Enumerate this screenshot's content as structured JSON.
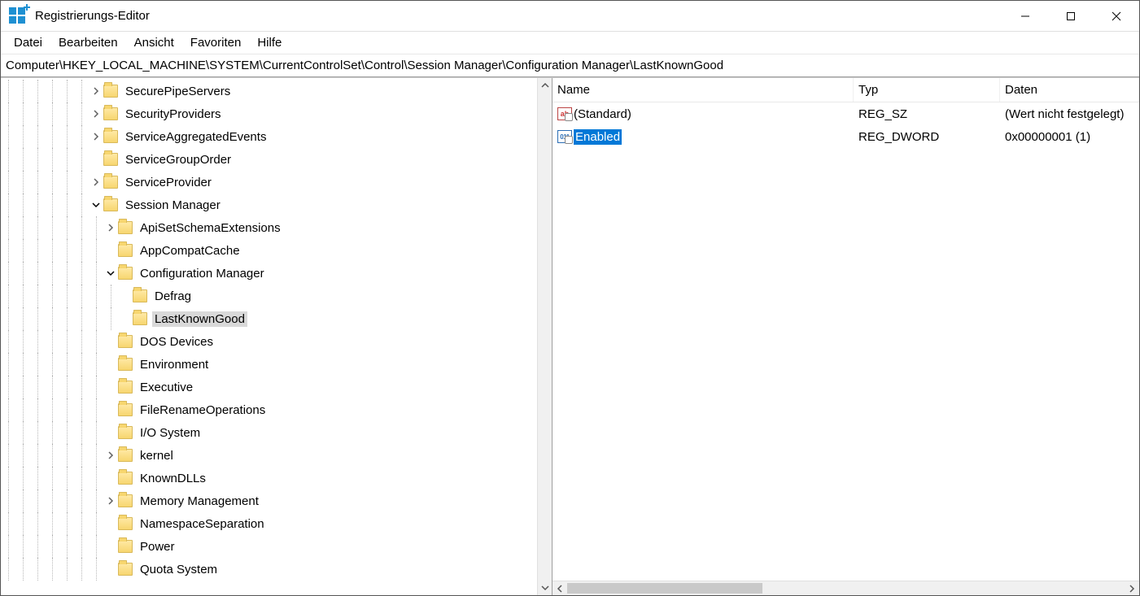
{
  "window": {
    "title": "Registrierungs-Editor"
  },
  "menu": {
    "items": [
      "Datei",
      "Bearbeiten",
      "Ansicht",
      "Favoriten",
      "Hilfe"
    ]
  },
  "address": "Computer\\HKEY_LOCAL_MACHINE\\SYSTEM\\CurrentControlSet\\Control\\Session Manager\\Configuration Manager\\LastKnownGood",
  "list": {
    "headers": {
      "name": "Name",
      "type": "Typ",
      "data": "Daten"
    },
    "rows": [
      {
        "icon": "ab",
        "name": "(Standard)",
        "type": "REG_SZ",
        "data": "(Wert nicht festgelegt)",
        "selected": false
      },
      {
        "icon": "bin",
        "name": "Enabled",
        "type": "REG_DWORD",
        "data": "0x00000001 (1)",
        "selected": true
      }
    ]
  },
  "tree": [
    {
      "depth": 5,
      "twist": "closed",
      "label": "SecurePipeServers"
    },
    {
      "depth": 5,
      "twist": "closed",
      "label": "SecurityProviders"
    },
    {
      "depth": 5,
      "twist": "closed",
      "label": "ServiceAggregatedEvents"
    },
    {
      "depth": 5,
      "twist": "none",
      "label": "ServiceGroupOrder"
    },
    {
      "depth": 5,
      "twist": "closed",
      "label": "ServiceProvider"
    },
    {
      "depth": 5,
      "twist": "open",
      "label": "Session Manager"
    },
    {
      "depth": 6,
      "twist": "closed",
      "label": "ApiSetSchemaExtensions"
    },
    {
      "depth": 6,
      "twist": "none",
      "label": "AppCompatCache"
    },
    {
      "depth": 6,
      "twist": "open",
      "label": "Configuration Manager"
    },
    {
      "depth": 7,
      "twist": "none",
      "label": "Defrag"
    },
    {
      "depth": 7,
      "twist": "none",
      "label": "LastKnownGood",
      "selected": true
    },
    {
      "depth": 6,
      "twist": "none",
      "label": "DOS Devices"
    },
    {
      "depth": 6,
      "twist": "none",
      "label": "Environment"
    },
    {
      "depth": 6,
      "twist": "none",
      "label": "Executive"
    },
    {
      "depth": 6,
      "twist": "none",
      "label": "FileRenameOperations"
    },
    {
      "depth": 6,
      "twist": "none",
      "label": "I/O System"
    },
    {
      "depth": 6,
      "twist": "closed",
      "label": "kernel"
    },
    {
      "depth": 6,
      "twist": "none",
      "label": "KnownDLLs"
    },
    {
      "depth": 6,
      "twist": "closed",
      "label": "Memory Management"
    },
    {
      "depth": 6,
      "twist": "none",
      "label": "NamespaceSeparation"
    },
    {
      "depth": 6,
      "twist": "none",
      "label": "Power"
    },
    {
      "depth": 6,
      "twist": "none",
      "label": "Quota System"
    }
  ],
  "columns": {
    "name_w": 370,
    "type_w": 180,
    "data_w": 260
  },
  "icon_text": {
    "ab": "ab",
    "bin": "011"
  }
}
